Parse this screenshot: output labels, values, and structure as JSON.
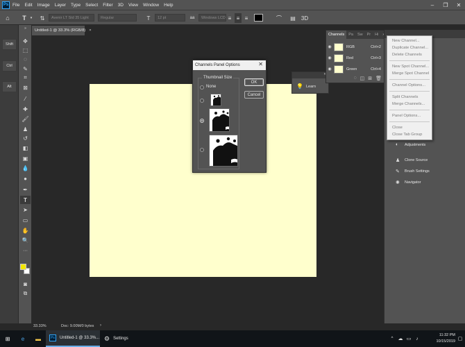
{
  "menubar": {
    "items": [
      "File",
      "Edit",
      "Image",
      "Layer",
      "Type",
      "Select",
      "Filter",
      "3D",
      "View",
      "Window",
      "Help"
    ],
    "app_logo": "Ps"
  },
  "optionsbar": {
    "font_family": "Avenir LT Std 35 Light",
    "font_style": "Regular",
    "font_size": "12 pt",
    "anti_alias": "Windows LCD"
  },
  "leftrail": {
    "buttons": [
      "Shift",
      "Ctrl",
      "Alt"
    ]
  },
  "document": {
    "tab_title": "Untitled-1 @ 33.3% (RGB/8)",
    "close": "×"
  },
  "statusbar": {
    "zoom": "33.33%",
    "doc_info": "Doc: 9.00M/0 bytes",
    "arrow": "›"
  },
  "dialog": {
    "title": "Channels Panel Options",
    "close": "✕",
    "group_label": "Thumbnail Size",
    "none_label": "None",
    "ok_label": "OK",
    "cancel_label": "Cancel",
    "selected_option": "medium"
  },
  "learn_panel": {
    "label": "Learn",
    "expand": "»"
  },
  "channels_panel": {
    "tabs": [
      "Channels",
      "Pa",
      "Sw",
      "Pr",
      "Hi"
    ],
    "expand": "»",
    "rows": [
      {
        "name": "RGB",
        "shortcut": "Ctrl+2"
      },
      {
        "name": "Red",
        "shortcut": "Ctrl+3"
      },
      {
        "name": "Green",
        "shortcut": "Ctrl+4"
      }
    ]
  },
  "right_dock": {
    "items": [
      {
        "label": "Adjustments",
        "icon": "adjustments-icon"
      },
      {
        "label": "Clone Source",
        "icon": "clone-source-icon"
      },
      {
        "label": "Brush Settings",
        "icon": "brush-settings-icon"
      },
      {
        "label": "Navigator",
        "icon": "navigator-icon"
      }
    ]
  },
  "context_menu": {
    "items": [
      "New Channel...",
      "Duplicate Channel...",
      "Delete Channels",
      "New Spot Channel...",
      "Merge Spot Channel",
      "Channel Options...",
      "Split Channels",
      "Merge Channels...",
      "Panel Options...",
      "Close",
      "Close Tab Group"
    ]
  },
  "taskbar": {
    "apps": [
      {
        "label": "Untitled-1 @ 33.3%...",
        "icon": "photoshop-icon"
      },
      {
        "label": "Settings",
        "icon": "settings-icon"
      }
    ],
    "time": "11:32 PM",
    "date": "10/15/2019"
  },
  "colors": {
    "canvas": "#ffffcd",
    "foreground_swatch": "#f2e600",
    "background_swatch": "#ffffff",
    "accent": "#31a8ff"
  }
}
